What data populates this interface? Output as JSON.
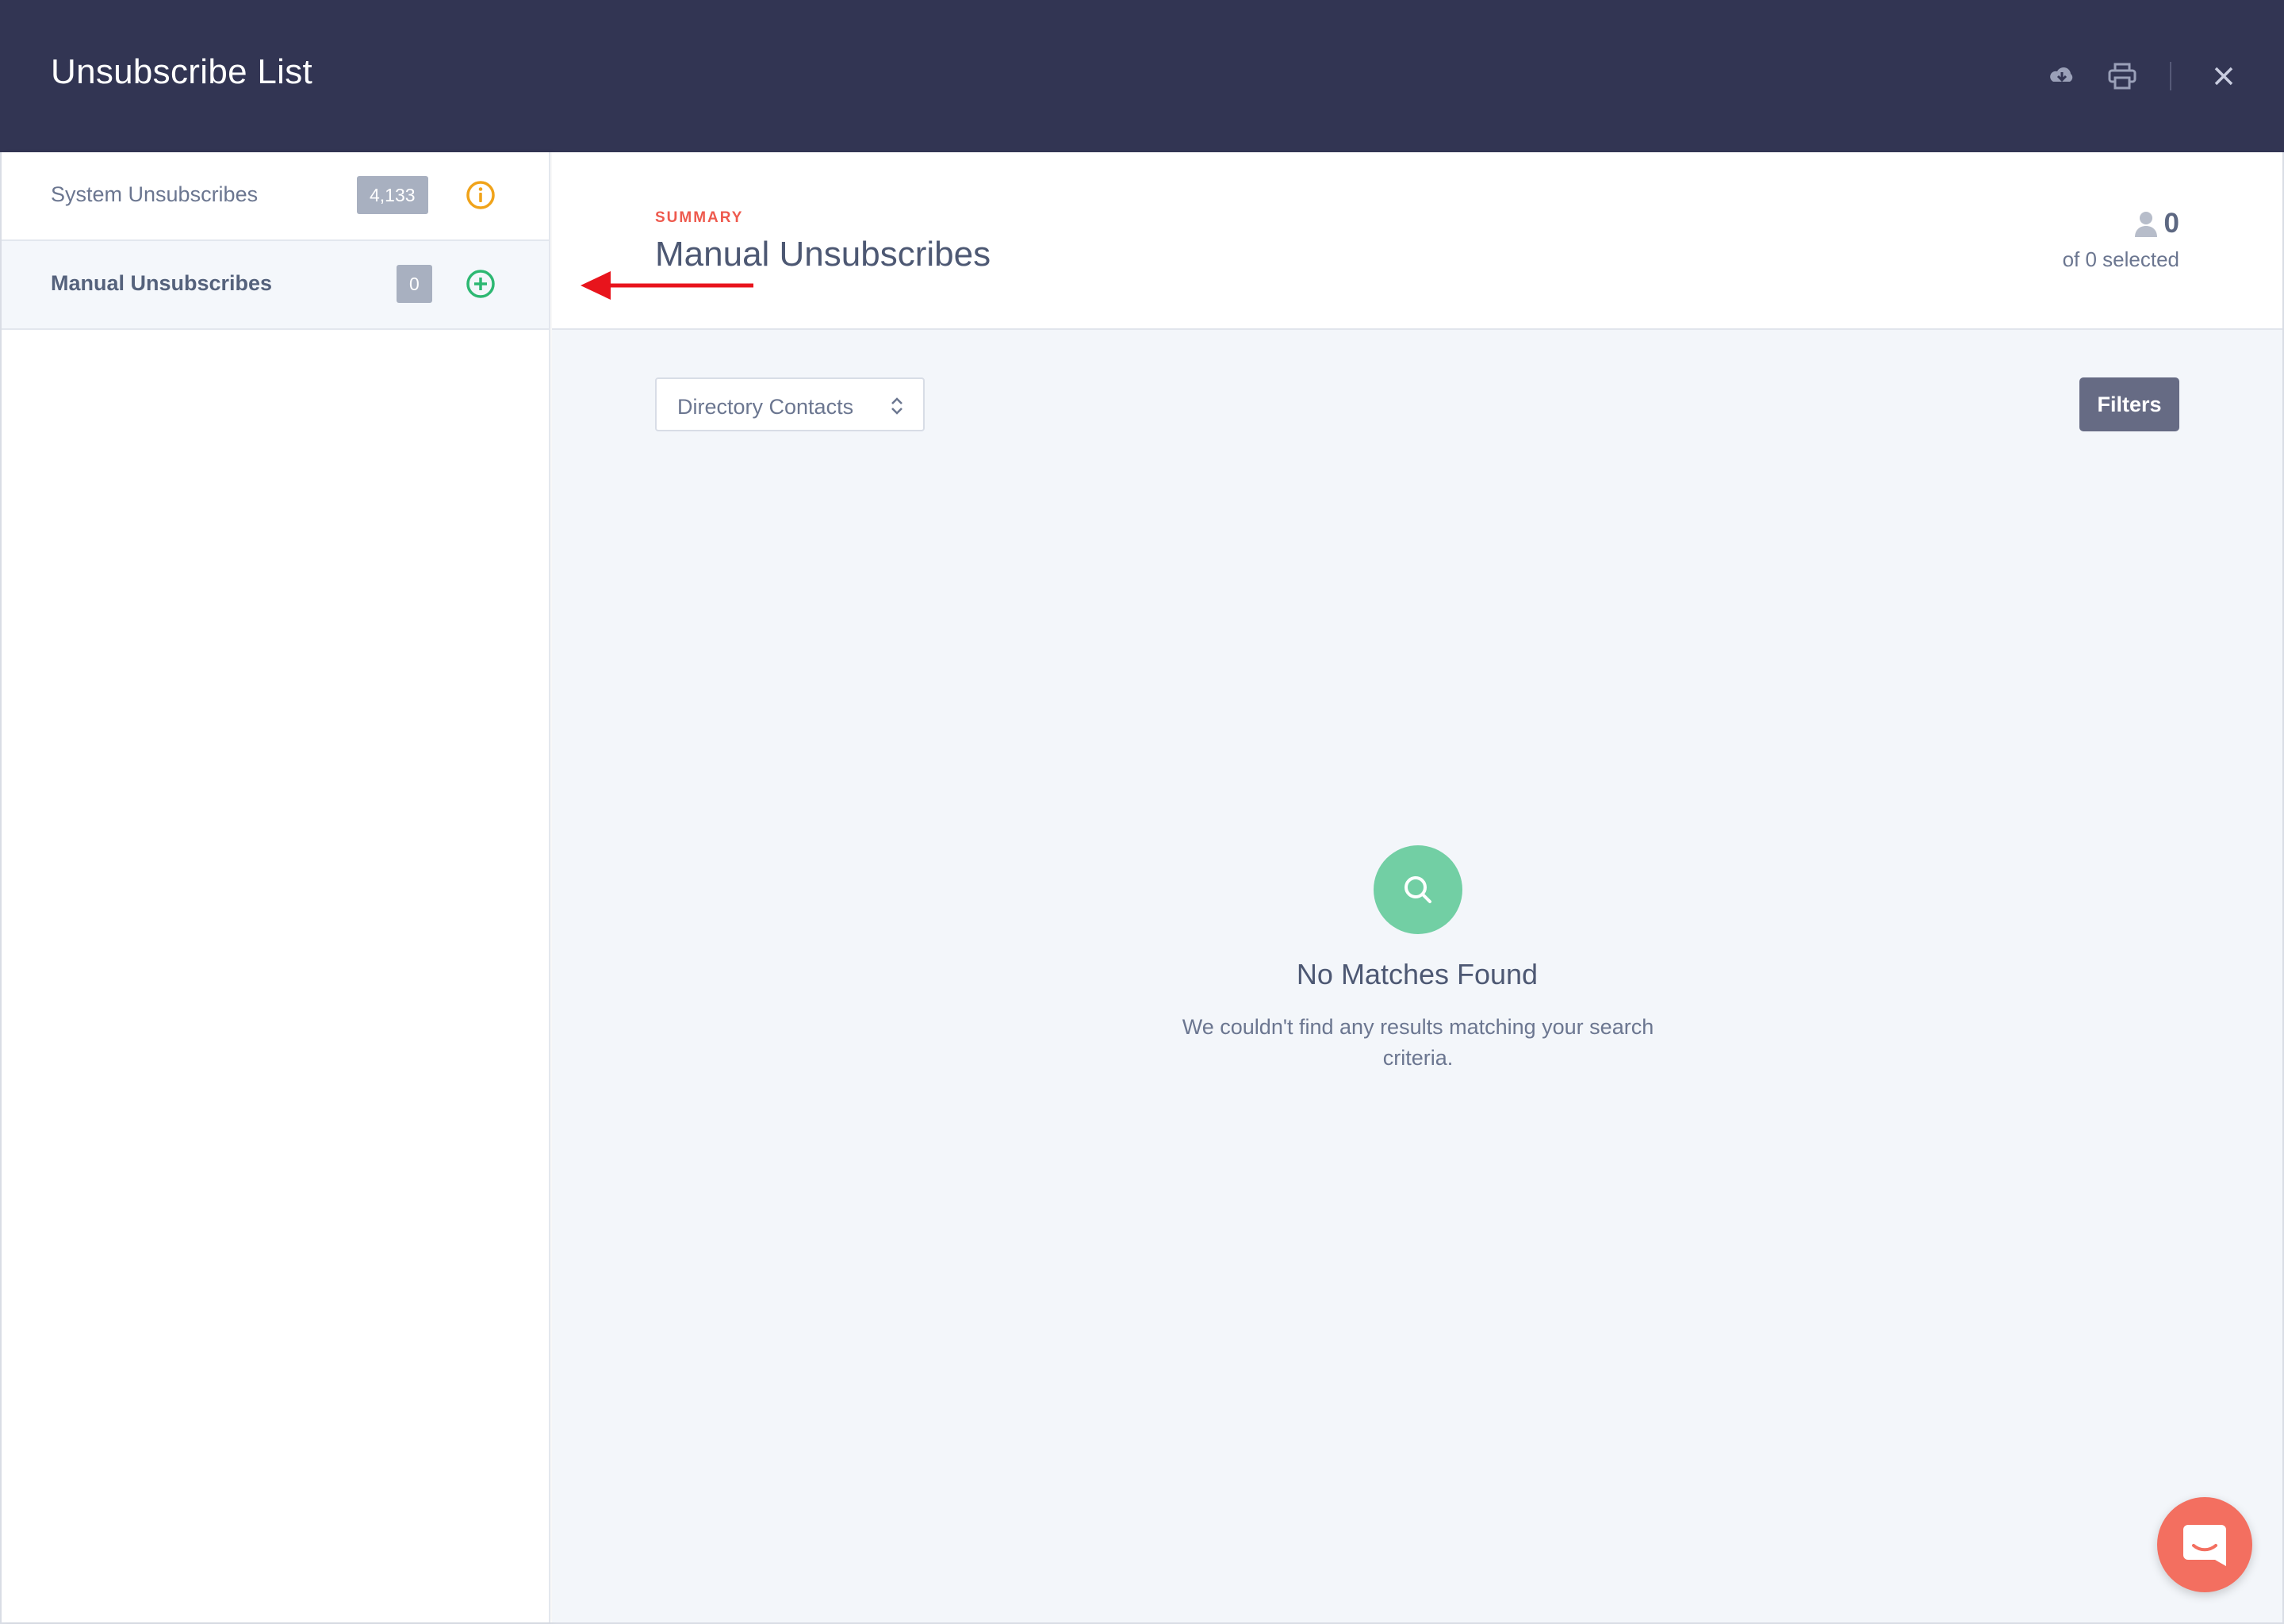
{
  "window": {
    "title": "Unsubscribe List",
    "actions": {
      "download_icon": "cloud-download-icon",
      "print_icon": "print-icon",
      "close_icon": "close-icon"
    }
  },
  "sidebar": {
    "items": [
      {
        "label": "System Unsubscribes",
        "count": "4,133",
        "icon": "info-icon",
        "icon_color": "#f0a31a"
      },
      {
        "label": "Manual Unsubscribes",
        "count": "0",
        "icon": "add-circle-icon",
        "icon_color": "#2db872",
        "active": true
      }
    ]
  },
  "main": {
    "section_label": "SUMMARY",
    "title": "Manual Unsubscribes",
    "selection": {
      "count": "0",
      "subtitle": "of 0 selected",
      "icon": "user-icon"
    },
    "dropdown": {
      "selected": "Directory Contacts",
      "icon": "chevron-up-down-icon"
    },
    "filters_button": "Filters",
    "empty_state": {
      "icon": "search-icon",
      "title": "No Matches Found",
      "description": "We couldn't find any results matching your search criteria."
    }
  },
  "chat_widget": {
    "icon": "chat-icon"
  },
  "colors": {
    "header_bg": "#323553",
    "accent_red": "#ee5a4e",
    "empty_icon_bg": "#72cfa4",
    "filters_bg": "#666b84",
    "chat_bg": "#f36f60"
  }
}
